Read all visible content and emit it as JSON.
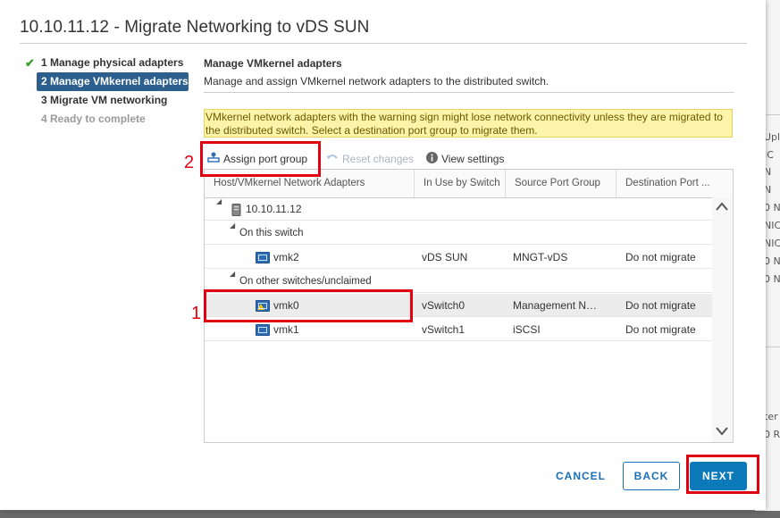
{
  "dialog": {
    "title": "10.10.11.12 - Migrate Networking to vDS SUN"
  },
  "steps": [
    {
      "label": "1 Manage physical adapters",
      "state": "completed"
    },
    {
      "label": "2 Manage VMkernel adapters",
      "state": "active"
    },
    {
      "label": "3 Migrate VM networking",
      "state": "pending"
    },
    {
      "label": "4 Ready to complete",
      "state": "disabled"
    }
  ],
  "content": {
    "title": "Manage VMkernel adapters",
    "subtitle": "Manage and assign VMkernel network adapters to the distributed switch.",
    "warning": "VMkernel network adapters with the warning sign might lose network connectivity unless they are migrated to the distributed switch. Select a destination port group to migrate them."
  },
  "toolbar": {
    "assign": "Assign port group",
    "reset": "Reset changes",
    "view": "View settings"
  },
  "table": {
    "columns": [
      "Host/VMkernel Network Adapters",
      "In Use by Switch",
      "Source Port Group",
      "Destination Port ..."
    ],
    "host": "10.10.11.12",
    "group_this": "On this switch",
    "group_other": "On other switches/unclaimed",
    "rows": [
      {
        "adapter": "vmk2",
        "switch": "vDS SUN",
        "source": "MNGT-vDS",
        "dest": "Do not migrate"
      },
      {
        "adapter": "vmk0",
        "switch": "vSwitch0",
        "source": "Management Net...",
        "dest": "Do not migrate"
      },
      {
        "adapter": "vmk1",
        "switch": "vSwitch1",
        "source": "iSCSI",
        "dest": "Do not migrate"
      }
    ]
  },
  "buttons": {
    "cancel": "CANCEL",
    "back": "BACK",
    "next": "NEXT"
  },
  "annotations": {
    "one": "1",
    "two": "2"
  },
  "background": {
    "items": [
      "Upl",
      "IC",
      "N",
      "N",
      "0 N",
      "NIC",
      "NIC",
      "0 N",
      "0 N",
      "ter",
      "0 R"
    ]
  },
  "colors": {
    "accent": "#0c7ab8",
    "active_step": "#2c5f8e",
    "warning_bg": "#fcf4a8",
    "annotation_red": "#e00010",
    "check_green": "#3f9a2f"
  }
}
